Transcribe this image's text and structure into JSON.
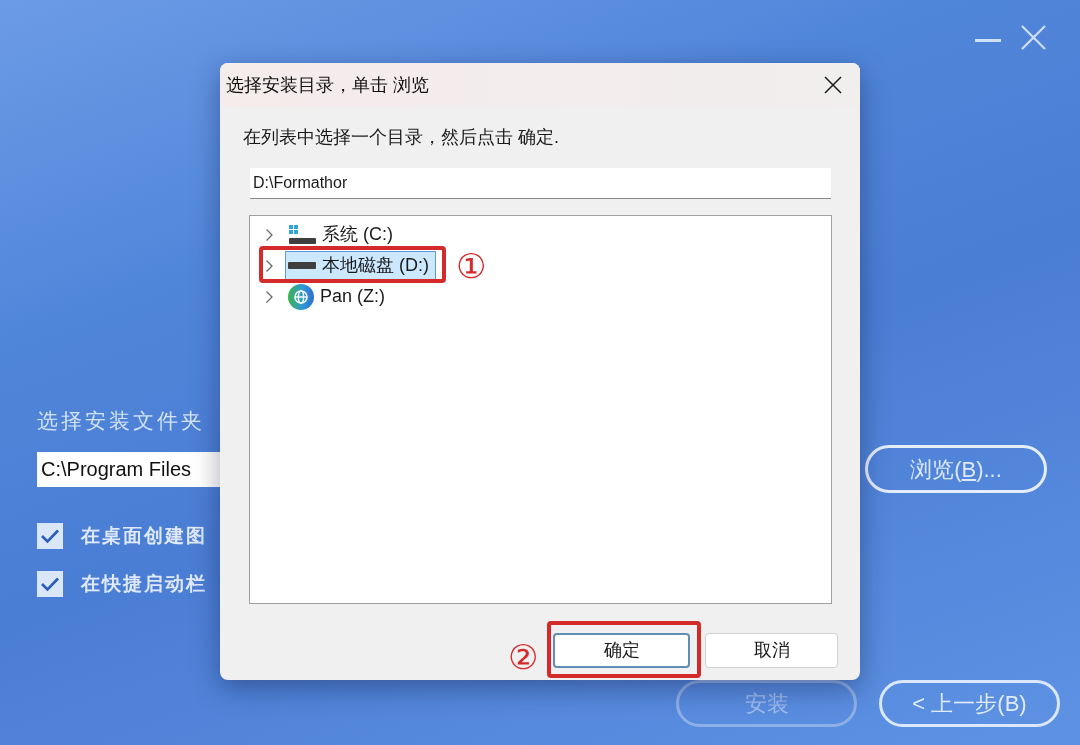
{
  "installer": {
    "folder_label": "选择安装文件夹",
    "path_field": {
      "value": "C:\\Program Files"
    },
    "browse_button": {
      "text_before": "浏览(",
      "hotkey": "B",
      "text_after": ")..."
    },
    "options": [
      {
        "label": "在桌面创建图",
        "checked": true
      },
      {
        "label": "在快捷启动栏",
        "checked": true
      }
    ],
    "buttons": [
      {
        "label": "安装",
        "disabled": true
      },
      {
        "label": "< 上一步(B)",
        "disabled": false
      }
    ]
  },
  "dialog": {
    "title": "选择安装目录，单击 浏览",
    "instruction": "在列表中选择一个目录，然后点击 确定.",
    "path_field": {
      "value": "D:\\Formathor"
    },
    "tree": [
      {
        "label": "系统 (C:)",
        "kind": "system",
        "expanded": false,
        "selected": false
      },
      {
        "label": "本地磁盘 (D:)",
        "kind": "drive",
        "expanded": false,
        "selected": true,
        "annotation": "①"
      },
      {
        "label": "Pan (Z:)",
        "kind": "network",
        "expanded": false,
        "selected": false
      }
    ],
    "buttons": [
      {
        "label": "确定",
        "default": true,
        "annotation": "②"
      },
      {
        "label": "取消",
        "default": false
      }
    ]
  }
}
